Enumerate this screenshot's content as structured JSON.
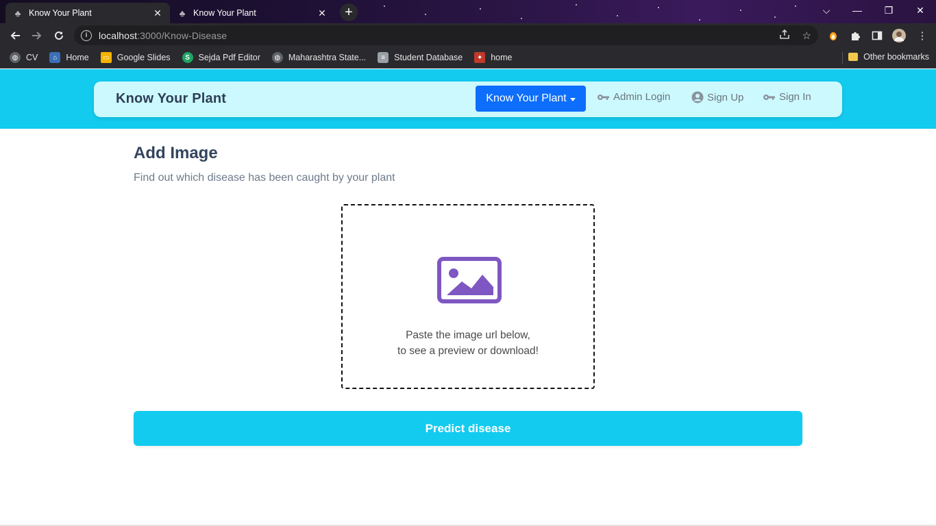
{
  "browser": {
    "tabs": [
      {
        "title": "Know Your Plant",
        "active": true
      },
      {
        "title": "Know Your Plant",
        "active": false
      }
    ],
    "new_tab_symbol": "+",
    "window_controls": {
      "chevron": "⌵",
      "minimize": "—",
      "restore": "❐",
      "close": "✕"
    },
    "url_host": "localhost",
    "url_rest": ":3000/Know-Disease",
    "bookmarks": [
      {
        "label": "CV",
        "icon": "globe-icon",
        "color": "#5f6368"
      },
      {
        "label": "Home",
        "icon": "site-icon",
        "color": "#3b6fb6"
      },
      {
        "label": "Google Slides",
        "icon": "slides-icon",
        "color": "#f4b400"
      },
      {
        "label": "Sejda Pdf Editor",
        "icon": "sejda-icon",
        "color": "#1fa463"
      },
      {
        "label": "Maharashtra State...",
        "icon": "globe-icon",
        "color": "#5f6368"
      },
      {
        "label": "Student Database",
        "icon": "database-icon",
        "color": "#9aa0a6"
      },
      {
        "label": "home",
        "icon": "emblem-icon",
        "color": "#c0392b"
      }
    ],
    "other_bookmarks": "Other bookmarks"
  },
  "navbar": {
    "brand": "Know Your Plant",
    "dropdown_label": "Know Your Plant",
    "links": {
      "admin_login": "Admin Login",
      "sign_up": "Sign Up",
      "sign_in": "Sign In"
    }
  },
  "main": {
    "title": "Add Image",
    "subtitle": "Find out which disease has been caught by your plant",
    "dropzone": {
      "line1": "Paste the image url below,",
      "line2": "to see a preview or download!",
      "icon": "image-icon",
      "icon_color": "#7e57c2"
    },
    "predict_button": "Predict disease"
  },
  "colors": {
    "header_bg": "#13cbef",
    "navbar_bg": "#ccf9fd",
    "primary": "#0d6efd"
  }
}
